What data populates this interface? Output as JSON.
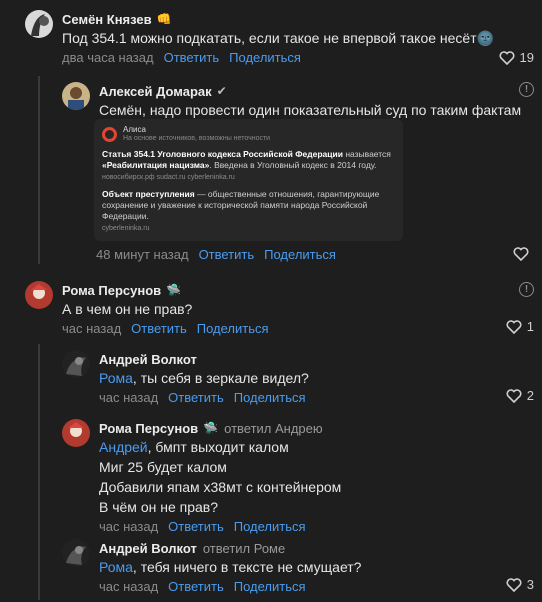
{
  "comments": [
    {
      "author": "Семён Князев",
      "badge": "👊",
      "text": "Под 354.1 можно подкатать, если такое не впервой такое несёт🌚",
      "time": "два часа назад",
      "reply": "Ответить",
      "share": "Поделиться",
      "likes": "19"
    },
    {
      "author": "Алексей Домарак",
      "badge": "✔",
      "text": "Семён, надо провести один показательный суд по таким фактам",
      "time": "48 минут назад",
      "reply": "Ответить",
      "share": "Поделиться",
      "likes": ""
    },
    {
      "author": "Рома Персунов",
      "badge": "🛸",
      "text": "А в чем он не прав?",
      "time": "час назад",
      "reply": "Ответить",
      "share": "Поделиться",
      "likes": "1"
    },
    {
      "author": "Андрей Волкот",
      "mention": "Рома",
      "text": ", ты себя в зеркале видел?",
      "time": "час назад",
      "reply": "Ответить",
      "share": "Поделиться",
      "likes": "2"
    },
    {
      "author": "Рома Персунов",
      "badge": "🛸",
      "replied_to": "ответил Андрею",
      "mention": "Андрей",
      "text": ", бмпт выходит калом",
      "lines": [
        "Миг 25 будет калом",
        "Добавили япам х38мт с контейнером",
        "В чём он не прав?"
      ],
      "time": "час назад",
      "reply": "Ответить",
      "share": "Поделиться",
      "likes": ""
    },
    {
      "author": "Андрей Волкот",
      "replied_to": "ответил Роме",
      "mention": "Рома",
      "text": ", тебя ничего в тексте не смущает?",
      "time": "час назад",
      "reply": "Ответить",
      "share": "Поделиться",
      "likes": "3"
    }
  ],
  "alice_card": {
    "title": "Алиса",
    "subtitle": "На основе источников, возможны неточности",
    "p1_bold": "Статья 354.1 Уголовного кодекса Российской Федерации",
    "p1_rest": " называется",
    "p1_line2_bold": "«Реабилитация нацизма»",
    "p1_line2_rest": ". Введена в Уголовный кодекс в 2014 году.",
    "p1_sources": "новосибирск.рф    sudact.ru    cyberleninka.ru",
    "p2_bold": "Объект преступления",
    "p2_rest": " — общественные отношения, гарантирующие сохранение и уважение к исторической памяти народа Российской Федерации.",
    "p2_sources": "cyberleninka.ru"
  },
  "colors": {
    "background": "#1e1e1e",
    "link": "#4a9cf0",
    "muted": "#8b8b8b"
  }
}
